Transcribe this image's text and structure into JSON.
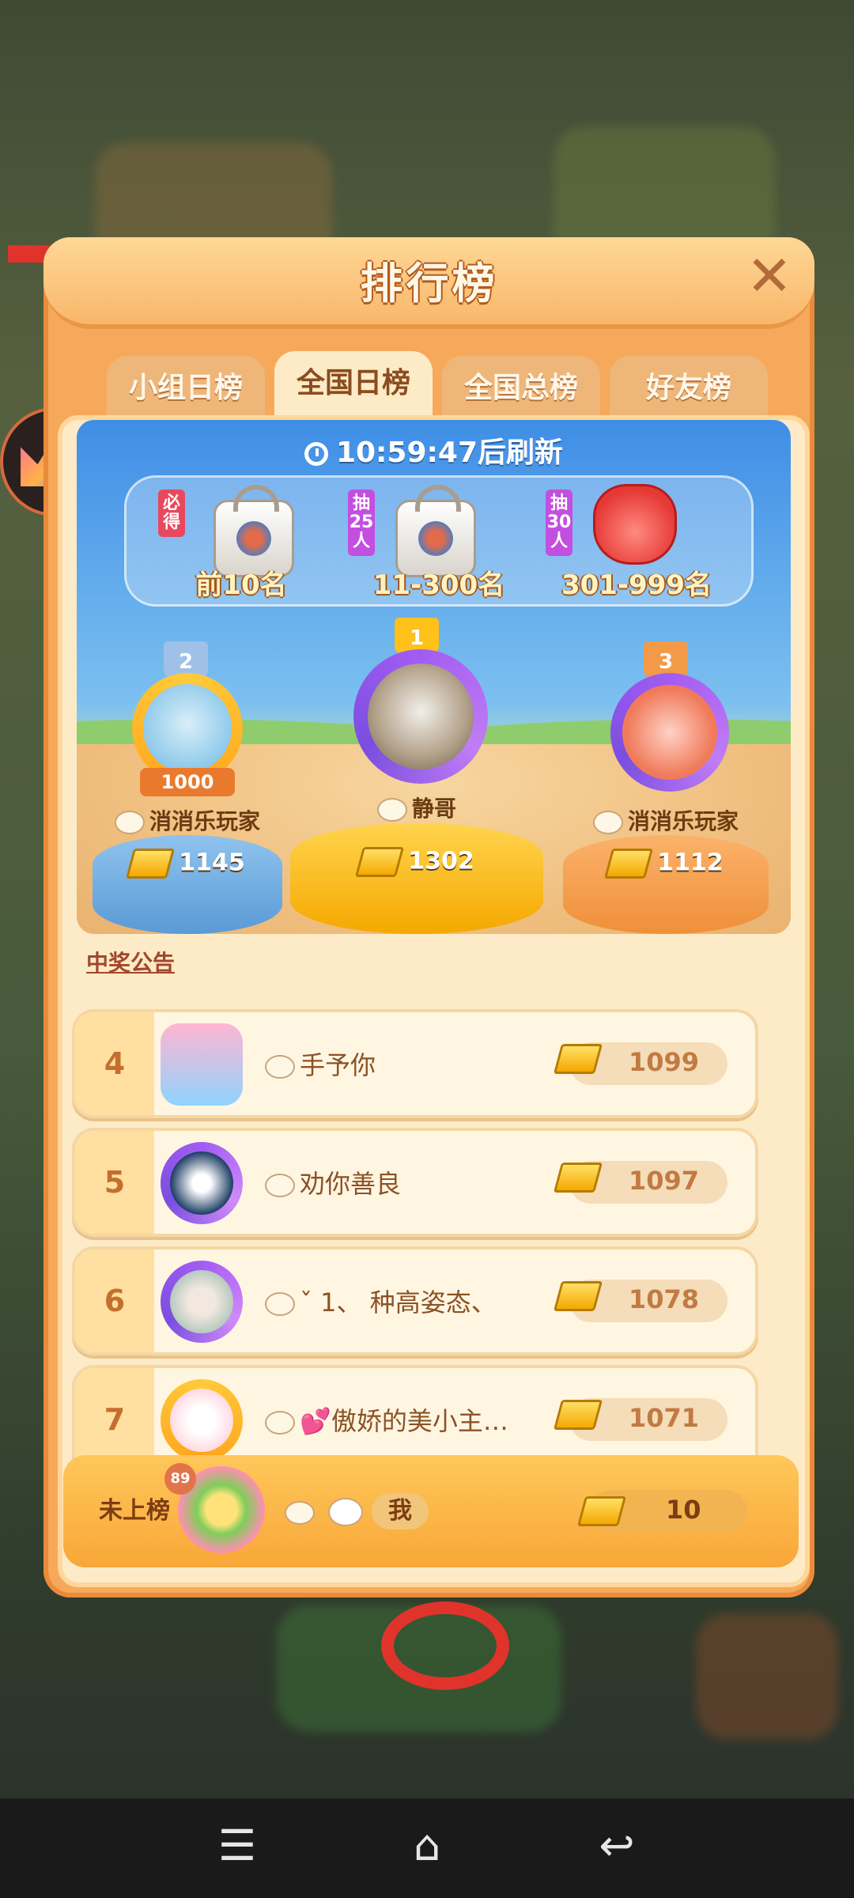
{
  "header": {
    "title": "排行榜",
    "close_icon": "close-icon"
  },
  "tabs": [
    {
      "label": "小组日榜",
      "active": false
    },
    {
      "label": "全国日榜",
      "active": true
    },
    {
      "label": "全国总榜",
      "active": false
    },
    {
      "label": "好友榜",
      "active": false
    }
  ],
  "countdown": {
    "time": "10:59:47",
    "suffix": "后刷新"
  },
  "prizes": [
    {
      "tag": "必得",
      "tag_color": "#e8485e",
      "label": "前10名",
      "icon": "gift-bag-icon"
    },
    {
      "tag": "抽25人",
      "tag_color": "#c24fe0",
      "label": "11-300名",
      "icon": "gift-bag-icon"
    },
    {
      "tag": "抽30人",
      "tag_color": "#c24fe0",
      "label": "301-999名",
      "icon": "fox-plush-icon"
    }
  ],
  "podium": {
    "first": {
      "rank": "1",
      "name": "静哥",
      "score": "1302"
    },
    "second": {
      "rank": "2",
      "name": "消消乐玩家",
      "score": "1145",
      "badge": "1000"
    },
    "third": {
      "rank": "3",
      "name": "消消乐玩家",
      "score": "1112"
    }
  },
  "announcement": "中奖公告",
  "rows": [
    {
      "rank": "4",
      "name": "手予你",
      "score": "1099"
    },
    {
      "rank": "5",
      "name": "劝你善良",
      "score": "1097"
    },
    {
      "rank": "6",
      "name": "ˇ 1、 种高姿态、",
      "score": "1078"
    },
    {
      "rank": "7",
      "name": "💕傲娇的美小主…",
      "score": "1071"
    }
  ],
  "me": {
    "rank": "未上榜",
    "name": "我",
    "score": "10",
    "level": "89"
  },
  "colors": {
    "panel": "#f6a95a",
    "accent": "#e0332c",
    "gold": "#f5a800"
  }
}
